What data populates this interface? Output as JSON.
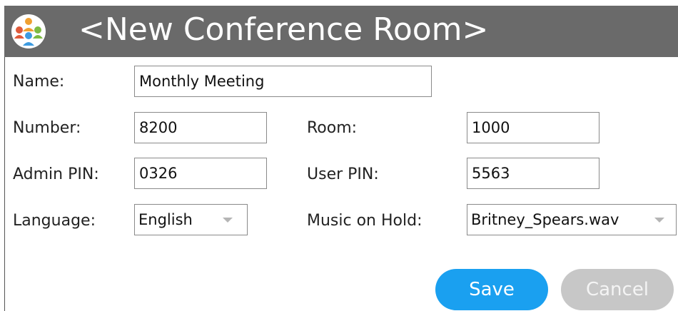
{
  "window": {
    "title": "<New Conference Room>",
    "icon": "conference-group-icon"
  },
  "form": {
    "name": {
      "label": "Name:",
      "value": "Monthly Meeting"
    },
    "number": {
      "label": "Number:",
      "value": "8200"
    },
    "room": {
      "label": "Room:",
      "value": "1000"
    },
    "admin_pin": {
      "label": "Admin PIN:",
      "value": "0326"
    },
    "user_pin": {
      "label": "User PIN:",
      "value": "5563"
    },
    "language": {
      "label": "Language:",
      "value": "English"
    },
    "music_on_hold": {
      "label": "Music on Hold:",
      "value": "Britney_Spears.wav"
    }
  },
  "actions": {
    "save_label": "Save",
    "cancel_label": "Cancel"
  },
  "colors": {
    "title_bar": "#6a6a6a",
    "save_button": "#1aa0f0",
    "cancel_button": "#c7c7c7"
  }
}
